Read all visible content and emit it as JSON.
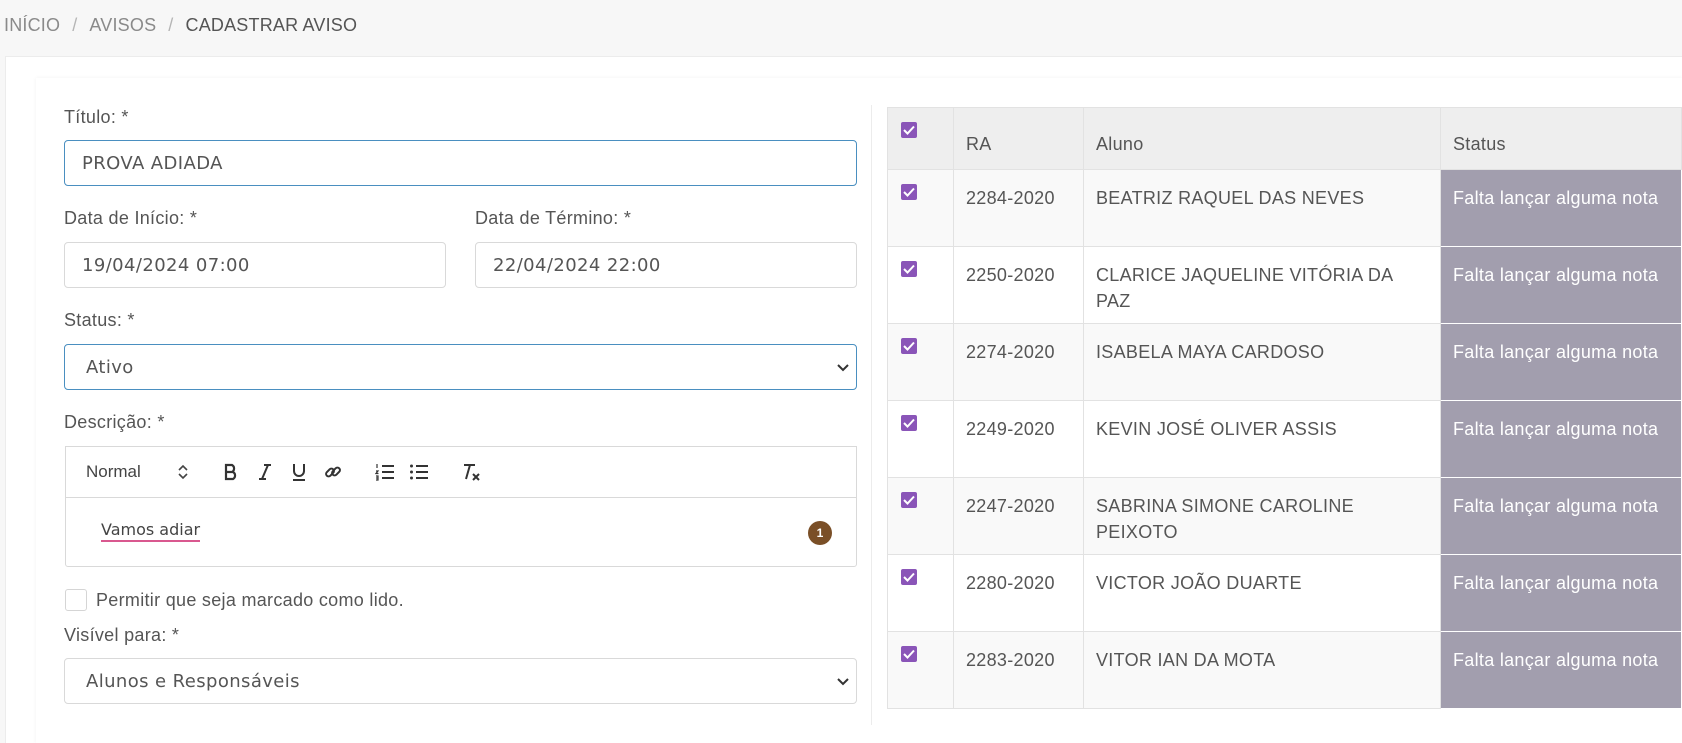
{
  "breadcrumb": {
    "home": "INÍCIO",
    "section": "AVISOS",
    "current": "CADASTRAR AVISO",
    "separator": "/"
  },
  "form": {
    "title_label": "Título: *",
    "title_value": "PROVA ADIADA",
    "start_label": "Data de Início: *",
    "start_value": "19/04/2024 07:00",
    "end_label": "Data de Término: *",
    "end_value": "22/04/2024 22:00",
    "status_label": "Status: *",
    "status_value": "Ativo",
    "description_label": "Descrição: *",
    "editor": {
      "format": "Normal",
      "text": "Vamos adiar",
      "badge": "1"
    },
    "allow_read_label": "Permitir que seja marcado como lido.",
    "visible_label": "Visível para: *",
    "visible_value": "Alunos e Responsáveis"
  },
  "table": {
    "headers": {
      "ra": "RA",
      "aluno": "Aluno",
      "status": "Status"
    },
    "rows": [
      {
        "ra": "2284-2020",
        "aluno": "BEATRIZ RAQUEL DAS NEVES",
        "status": "Falta lançar alguma nota"
      },
      {
        "ra": "2250-2020",
        "aluno": "CLARICE JAQUELINE VITÓRIA DA PAZ",
        "status": "Falta lançar alguma nota"
      },
      {
        "ra": "2274-2020",
        "aluno": "ISABELA MAYA CARDOSO",
        "status": "Falta lançar alguma nota"
      },
      {
        "ra": "2249-2020",
        "aluno": "KEVIN JOSÉ OLIVER ASSIS",
        "status": "Falta lançar alguma nota"
      },
      {
        "ra": "2247-2020",
        "aluno": "SABRINA SIMONE CAROLINE PEIXOTO",
        "status": "Falta lançar alguma nota"
      },
      {
        "ra": "2280-2020",
        "aluno": "VICTOR JOÃO DUARTE",
        "status": "Falta lançar alguma nota"
      },
      {
        "ra": "2283-2020",
        "aluno": "VITOR IAN DA MOTA",
        "status": "Falta lançar alguma nota"
      }
    ]
  },
  "colors": {
    "checkbox": "#8a55b8",
    "status_bg": "#a29eae",
    "focus_border": "#4a8fc0",
    "badge": "#7a4f27"
  }
}
